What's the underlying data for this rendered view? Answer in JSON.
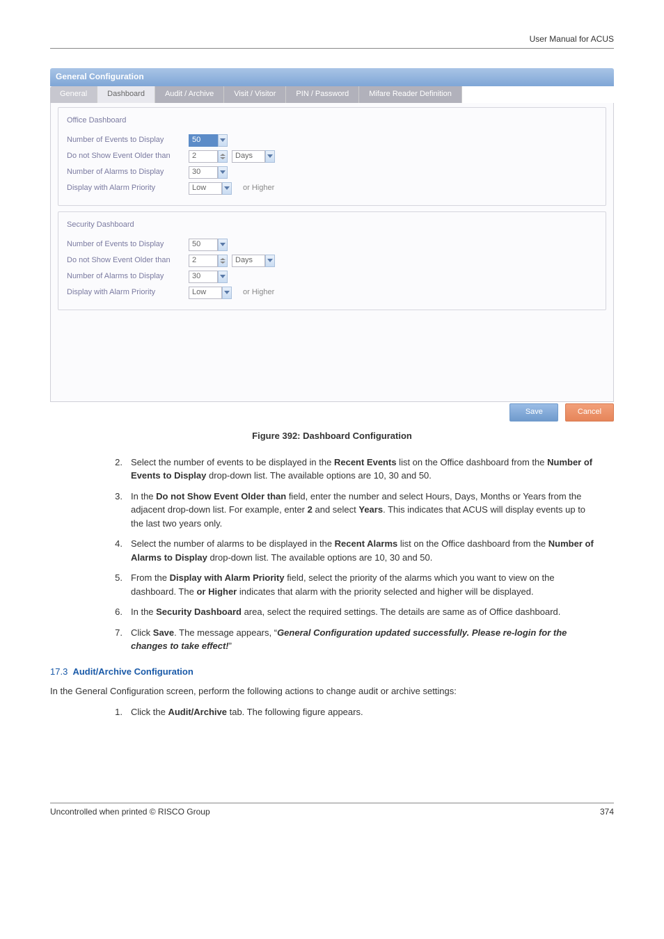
{
  "header": {
    "doc_title": "User Manual for ACUS"
  },
  "window": {
    "title": "General Configuration",
    "tabs": [
      "General",
      "Dashboard",
      "Audit / Archive",
      "Visit / Visitor",
      "PIN / Password",
      "Mifare Reader Definition"
    ],
    "active_tab_index": 1,
    "office": {
      "legend": "Office Dashboard",
      "events_label": "Number of Events to Display",
      "events_value": "50",
      "older_label": "Do not Show Event Older than",
      "older_value": "2",
      "older_unit": "Days",
      "alarms_label": "Number of Alarms to Display",
      "alarms_value": "30",
      "priority_label": "Display with Alarm Priority",
      "priority_value": "Low",
      "priority_suffix": "or Higher"
    },
    "security": {
      "legend": "Security Dashboard",
      "events_label": "Number of Events to Display",
      "events_value": "50",
      "older_label": "Do not Show Event Older than",
      "older_value": "2",
      "older_unit": "Days",
      "alarms_label": "Number of Alarms to Display",
      "alarms_value": "30",
      "priority_label": "Display with Alarm Priority",
      "priority_value": "Low",
      "priority_suffix": "or Higher"
    },
    "save_btn": "Save",
    "cancel_btn": "Cancel"
  },
  "figure_caption": "Figure 392: Dashboard Configuration",
  "steps": {
    "s2_a": "Select the number of events to be displayed in the ",
    "s2_b": "Recent Events",
    "s2_c": " list on the Office dashboard from the ",
    "s2_d": "Number of Events to Display",
    "s2_e": " drop-down list. The available options are 10, 30 and 50.",
    "s3_a": "In the ",
    "s3_b": "Do not Show Event Older than",
    "s3_c": " field, enter the number and select Hours, Days, Months or Years from the adjacent drop-down list. For example, enter ",
    "s3_d": "2",
    "s3_e": " and select ",
    "s3_f": "Years",
    "s3_g": ". This indicates that ACUS will display events up to the last two years only.",
    "s4_a": "Select the number of alarms to be displayed in the ",
    "s4_b": "Recent Alarms",
    "s4_c": " list on the Office dashboard from the ",
    "s4_d": "Number of Alarms to Display",
    "s4_e": " drop-down list. The available options are 10, 30 and 50.",
    "s5_a": "From the ",
    "s5_b": "Display with Alarm Priority",
    "s5_c": " field, select the priority of the alarms which you want to view on the dashboard. The ",
    "s5_d": "or Higher",
    "s5_e": " indicates that alarm with the priority selected and higher will be displayed.",
    "s6_a": "In the ",
    "s6_b": "Security Dashboard",
    "s6_c": " area, select the required settings. The details are same as of Office dashboard.",
    "s7_a": "Click ",
    "s7_b": "Save",
    "s7_c": ". The message appears, “",
    "s7_d": "General Configuration updated successfully. Please re-login for the changes to take effect!",
    "s7_e": "”"
  },
  "section": {
    "num": "17.3",
    "title": "Audit/Archive Configuration",
    "intro": "In the General Configuration screen, perform the following actions to change audit or archive settings:",
    "step1_a": "Click the ",
    "step1_b": "Audit/Archive",
    "step1_c": " tab. The following figure appears."
  },
  "footer": {
    "left": "Uncontrolled when printed © RISCO Group",
    "right": "374"
  }
}
